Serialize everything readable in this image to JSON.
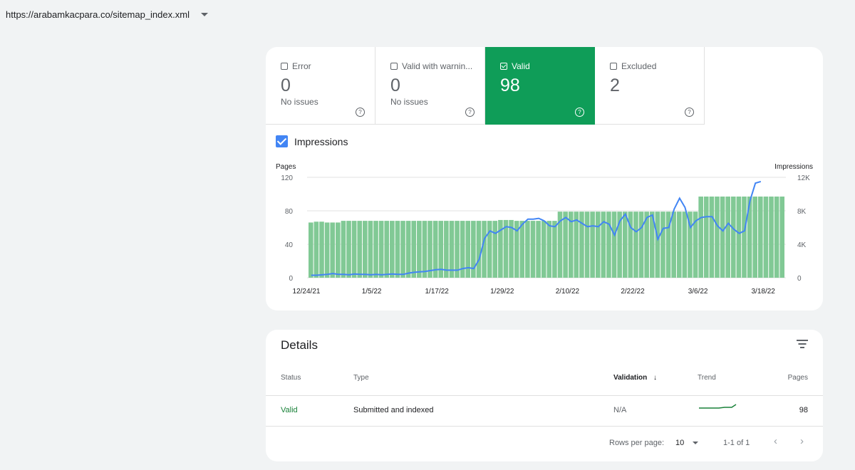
{
  "url_selector": {
    "value": "https://arabamkacpara.co/sitemap_index.xml"
  },
  "tiles": [
    {
      "label": "Error",
      "value": "0",
      "sub": "No issues",
      "checked": false
    },
    {
      "label": "Valid with warnin...",
      "value": "0",
      "sub": "No issues",
      "checked": false
    },
    {
      "label": "Valid",
      "value": "98",
      "sub": "",
      "checked": true
    },
    {
      "label": "Excluded",
      "value": "2",
      "sub": "",
      "checked": false
    }
  ],
  "impressions_toggle": {
    "label": "Impressions",
    "checked": true
  },
  "chart_data": {
    "type": "bar",
    "left_axis_title": "Pages",
    "right_axis_title": "Impressions",
    "y_left_ticks": [
      "120",
      "80",
      "40",
      "0"
    ],
    "y_right_ticks": [
      "12K",
      "8K",
      "4K",
      "0"
    ],
    "y_left_range": [
      0,
      120
    ],
    "y_right_range": [
      0,
      12000
    ],
    "x_tick_labels": [
      "12/24/21",
      "1/5/22",
      "1/17/22",
      "1/29/22",
      "2/10/22",
      "2/22/22",
      "3/6/22",
      "3/18/22"
    ],
    "grid": true,
    "bar_color": "#81c995",
    "line_color": "#4285f4",
    "series": [
      {
        "name": "Pages",
        "values": [
          66,
          67,
          67,
          66,
          66,
          66,
          68,
          68,
          68,
          68,
          68,
          68,
          68,
          68,
          68,
          68,
          68,
          68,
          68,
          68,
          68,
          68,
          68,
          68,
          68,
          68,
          68,
          68,
          68,
          68,
          68,
          68,
          68,
          68,
          68,
          69,
          69,
          69,
          68,
          68,
          68,
          68,
          68,
          68,
          68,
          68,
          79,
          79,
          79,
          79,
          79,
          79,
          79,
          79,
          79,
          79,
          79,
          79,
          79,
          79,
          79,
          79,
          79,
          79,
          79,
          79,
          79,
          79,
          79,
          79,
          79,
          79,
          97,
          97,
          97,
          97,
          97,
          97,
          97,
          97,
          97,
          97,
          97,
          97,
          97,
          97,
          97,
          97
        ]
      },
      {
        "name": "Impressions",
        "values": [
          300,
          300,
          350,
          400,
          500,
          400,
          400,
          350,
          450,
          400,
          400,
          350,
          400,
          350,
          400,
          450,
          400,
          400,
          550,
          650,
          700,
          750,
          850,
          950,
          1000,
          900,
          900,
          900,
          1100,
          1200,
          1100,
          2200,
          4700,
          5600,
          5300,
          5700,
          6100,
          6000,
          5600,
          6400,
          7000,
          7000,
          7100,
          6800,
          6200,
          6100,
          6800,
          7200,
          6700,
          6900,
          6500,
          6100,
          6200,
          6100,
          6700,
          6400,
          5100,
          6800,
          7600,
          6000,
          5500,
          6000,
          7200,
          7500,
          4600,
          5900,
          6000,
          8200,
          9500,
          8400,
          6000,
          6800,
          7200,
          7300,
          7300,
          6200,
          5600,
          6500,
          5800,
          5300,
          5600,
          9200,
          11300,
          11500
        ]
      }
    ]
  },
  "details": {
    "title": "Details",
    "headers": {
      "status": "Status",
      "type": "Type",
      "validation": "Validation",
      "trend": "Trend",
      "pages": "Pages"
    },
    "rows": [
      {
        "status": "Valid",
        "type": "Submitted and indexed",
        "validation": "N/A",
        "pages": "98"
      }
    ],
    "footer": {
      "rows_per_page_label": "Rows per page:",
      "rows_per_page_value": "10",
      "range": "1-1 of 1"
    }
  }
}
